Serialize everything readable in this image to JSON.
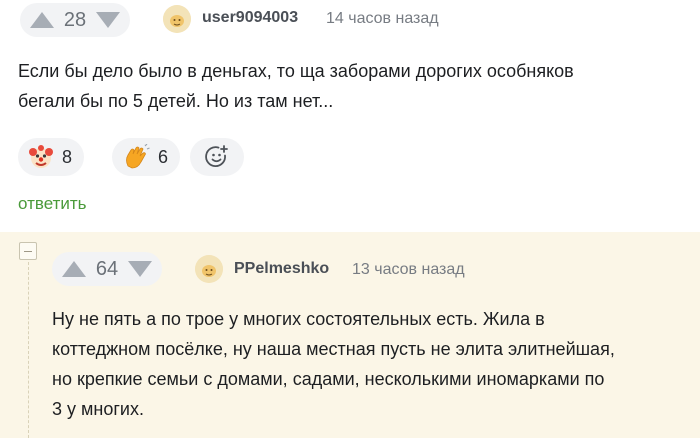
{
  "comment1": {
    "rating": "28",
    "username": "user9094003",
    "time": "14 часов назад",
    "text_lines": [
      "Если бы дело было в деньгах, то ща заборами дорогих особняков",
      "бегали бы по 5 детей. Но из там нет..."
    ],
    "reactions": [
      {
        "icon": "clown-face-icon",
        "count": "8"
      },
      {
        "icon": "waving-hand-icon",
        "count": "6"
      }
    ],
    "reply_label": "ответить"
  },
  "comment2": {
    "rating": "64",
    "username": "PPelmeshko",
    "time": "13 часов назад",
    "text_lines": [
      "Ну не пять а по трое у многих состоятельных есть. Жила в",
      "коттеджном посёлке, ну наша местная пусть не элита элитнейшая,",
      "но крепкие семьи с домами, садами, несколькими иномарками по",
      "3 у многих."
    ]
  },
  "colors": {
    "reply_green": "#4a9a3a",
    "thread_bg": "#fbf6e7",
    "pill_bg": "#f2f3f5",
    "arrow_gray": "#a7adb5"
  }
}
